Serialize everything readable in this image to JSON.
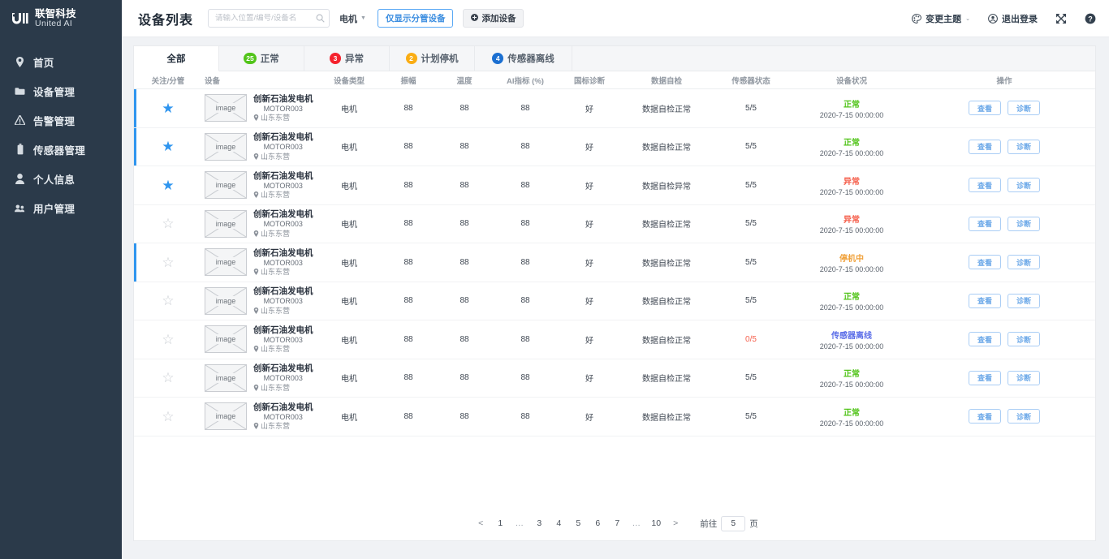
{
  "brand": {
    "name_cn": "联智科技",
    "name_en": "United  AI",
    "logo_icon": "uni-logo-icon"
  },
  "sidebar": {
    "bg": "#2b3a4a",
    "items": [
      {
        "label": "首页",
        "icon": "location-pin-icon"
      },
      {
        "label": "设备管理",
        "icon": "folder-icon"
      },
      {
        "label": "告警管理",
        "icon": "warning-triangle-icon"
      },
      {
        "label": "传感器管理",
        "icon": "sensor-battery-icon"
      },
      {
        "label": "个人信息",
        "icon": "user-icon"
      },
      {
        "label": "用户管理",
        "icon": "users-group-icon"
      }
    ]
  },
  "topbar": {
    "title": "设备列表",
    "search": {
      "value": "",
      "placeholder": "请输入位置/编号/设备名",
      "icon": "search-icon"
    },
    "type_filter": {
      "value": "电机",
      "icon": "chevron-down-icon"
    },
    "filter_button": "仅显示分管设备",
    "add_button": "添加设备",
    "add_button_icon": "plus-circle-icon",
    "theme": {
      "label": "变更主题",
      "icon": "palette-icon",
      "caret": "chevron-down-icon"
    },
    "logout": {
      "label": "退出登录",
      "icon": "user-circle-icon"
    },
    "fullscreen_icon": "fullscreen-expand-icon",
    "help_icon": "question-circle-icon"
  },
  "tabs": [
    {
      "label": "全部",
      "count": "",
      "color": "",
      "active": true
    },
    {
      "label": "正常",
      "count": "25",
      "color": "#52c41a",
      "active": false
    },
    {
      "label": "异常",
      "count": "3",
      "color": "#f5222d",
      "active": false
    },
    {
      "label": "计划停机",
      "count": "2",
      "color": "#faad14",
      "active": false
    },
    {
      "label": "传感器离线",
      "count": "4",
      "color": "#1b6fd1",
      "active": false
    }
  ],
  "table": {
    "columns": [
      "关注/分管",
      "设备",
      "设备类型",
      "振幅",
      "温度",
      "AI指标 (%)",
      "国标诊断",
      "数据自检",
      "传感器状态",
      "设备状况",
      "操作"
    ],
    "actions": {
      "view": "查看",
      "diagnose": "诊断"
    },
    "thumb_label": "image",
    "location_icon": "location-pin-icon",
    "rows": [
      {
        "starred": true,
        "marked": true,
        "device_name": "创新石油发电机",
        "device_code": "MOTOR003",
        "location": "山东东营",
        "type": "电机",
        "amplitude": "88",
        "temperature": "88",
        "ai_index": "88",
        "gb_diagnosis": "好",
        "self_check": "数据自检正常",
        "sensor_state": "5/5",
        "sensor_state_color": "#3e4651",
        "status": "正常",
        "status_color": "#52c41a",
        "time": "2020-7-15  00:00:00"
      },
      {
        "starred": true,
        "marked": true,
        "device_name": "创新石油发电机",
        "device_code": "MOTOR003",
        "location": "山东东营",
        "type": "电机",
        "amplitude": "88",
        "temperature": "88",
        "ai_index": "88",
        "gb_diagnosis": "好",
        "self_check": "数据自检正常",
        "sensor_state": "5/5",
        "sensor_state_color": "#3e4651",
        "status": "正常",
        "status_color": "#52c41a",
        "time": "2020-7-15  00:00:00"
      },
      {
        "starred": true,
        "marked": false,
        "device_name": "创新石油发电机",
        "device_code": "MOTOR003",
        "location": "山东东营",
        "type": "电机",
        "amplitude": "88",
        "temperature": "88",
        "ai_index": "88",
        "gb_diagnosis": "好",
        "self_check": "数据自检异常",
        "sensor_state": "5/5",
        "sensor_state_color": "#3e4651",
        "status": "异常",
        "status_color": "#f5604d",
        "time": "2020-7-15  00:00:00"
      },
      {
        "starred": false,
        "marked": false,
        "device_name": "创新石油发电机",
        "device_code": "MOTOR003",
        "location": "山东东营",
        "type": "电机",
        "amplitude": "88",
        "temperature": "88",
        "ai_index": "88",
        "gb_diagnosis": "好",
        "self_check": "数据自检正常",
        "sensor_state": "5/5",
        "sensor_state_color": "#3e4651",
        "status": "异常",
        "status_color": "#f5604d",
        "time": "2020-7-15  00:00:00"
      },
      {
        "starred": false,
        "marked": true,
        "device_name": "创新石油发电机",
        "device_code": "MOTOR003",
        "location": "山东东营",
        "type": "电机",
        "amplitude": "88",
        "temperature": "88",
        "ai_index": "88",
        "gb_diagnosis": "好",
        "self_check": "数据自检正常",
        "sensor_state": "5/5",
        "sensor_state_color": "#3e4651",
        "status": "停机中",
        "status_color": "#f0a23c",
        "time": "2020-7-15  00:00:00"
      },
      {
        "starred": false,
        "marked": false,
        "device_name": "创新石油发电机",
        "device_code": "MOTOR003",
        "location": "山东东营",
        "type": "电机",
        "amplitude": "88",
        "temperature": "88",
        "ai_index": "88",
        "gb_diagnosis": "好",
        "self_check": "数据自检正常",
        "sensor_state": "5/5",
        "sensor_state_color": "#3e4651",
        "status": "正常",
        "status_color": "#52c41a",
        "time": "2020-7-15  00:00:00"
      },
      {
        "starred": false,
        "marked": false,
        "device_name": "创新石油发电机",
        "device_code": "MOTOR003",
        "location": "山东东营",
        "type": "电机",
        "amplitude": "88",
        "temperature": "88",
        "ai_index": "88",
        "gb_diagnosis": "好",
        "self_check": "数据自检正常",
        "sensor_state": "0/5",
        "sensor_state_color": "#f5604d",
        "status": "传感器离线",
        "status_color": "#5b6ee8",
        "time": "2020-7-15  00:00:00"
      },
      {
        "starred": false,
        "marked": false,
        "device_name": "创新石油发电机",
        "device_code": "MOTOR003",
        "location": "山东东营",
        "type": "电机",
        "amplitude": "88",
        "temperature": "88",
        "ai_index": "88",
        "gb_diagnosis": "好",
        "self_check": "数据自检正常",
        "sensor_state": "5/5",
        "sensor_state_color": "#3e4651",
        "status": "正常",
        "status_color": "#52c41a",
        "time": "2020-7-15  00:00:00"
      },
      {
        "starred": false,
        "marked": false,
        "device_name": "创新石油发电机",
        "device_code": "MOTOR003",
        "location": "山东东营",
        "type": "电机",
        "amplitude": "88",
        "temperature": "88",
        "ai_index": "88",
        "gb_diagnosis": "好",
        "self_check": "数据自检正常",
        "sensor_state": "5/5",
        "sensor_state_color": "#3e4651",
        "status": "正常",
        "status_color": "#52c41a",
        "time": "2020-7-15  00:00:00"
      }
    ]
  },
  "pagination": {
    "prev": "<",
    "next": ">",
    "pages": [
      "1",
      "…",
      "3",
      "4",
      "5",
      "6",
      "7",
      "…",
      "10"
    ],
    "goto_prefix": "前往",
    "goto_value": "5",
    "goto_suffix": "页"
  }
}
